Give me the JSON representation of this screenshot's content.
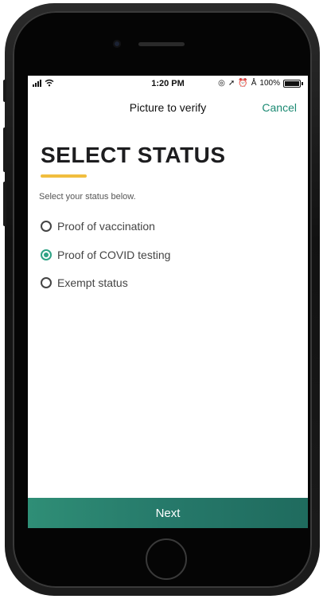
{
  "status_bar": {
    "time": "1:20 PM",
    "battery": "100%"
  },
  "nav": {
    "title": "Picture to verify",
    "cancel_label": "Cancel"
  },
  "page": {
    "heading": "SELECT STATUS",
    "subtitle": "Select your status below."
  },
  "options": [
    {
      "label": "Proof of vaccination",
      "selected": false
    },
    {
      "label": "Proof of COVID testing",
      "selected": true
    },
    {
      "label": "Exempt status",
      "selected": false
    }
  ],
  "footer": {
    "next_label": "Next"
  },
  "colors": {
    "accent": "#1c8a73",
    "underline": "#f1be3e",
    "button": "#26796a"
  }
}
